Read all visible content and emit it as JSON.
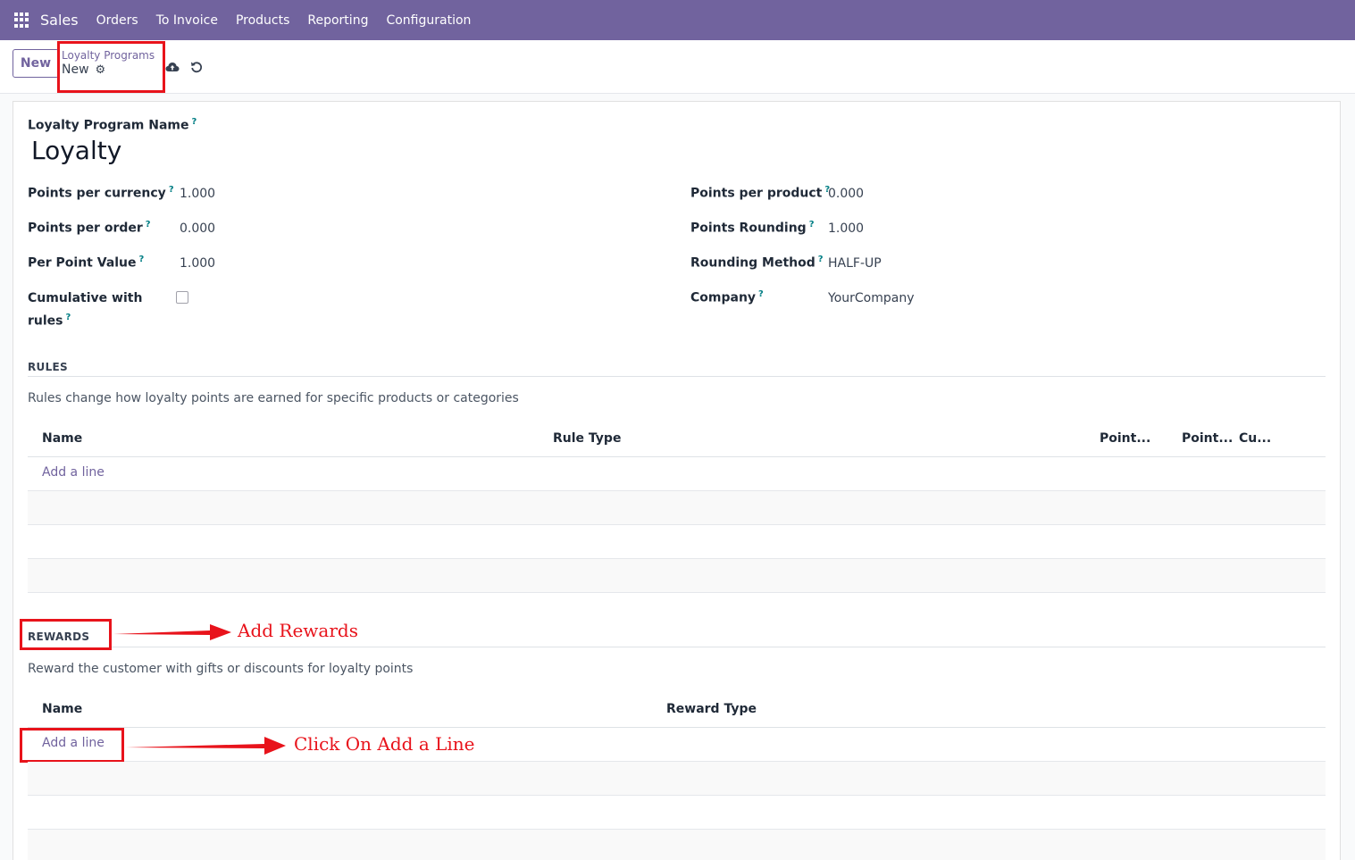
{
  "navbar": {
    "app_name": "Sales",
    "menu": [
      "Orders",
      "To Invoice",
      "Products",
      "Reporting",
      "Configuration"
    ]
  },
  "control": {
    "new_button": "New",
    "breadcrumb_parent": "Loyalty Programs",
    "breadcrumb_current": "New"
  },
  "form": {
    "name_label": "Loyalty Program Name",
    "name_value": "Loyalty",
    "left_fields": [
      {
        "label": "Points per currency",
        "value": "1.000"
      },
      {
        "label": "Points per order",
        "value": "0.000"
      },
      {
        "label": "Per Point Value",
        "value": "1.000"
      }
    ],
    "cumulative_label_1": "Cumulative with",
    "cumulative_label_2": "rules",
    "cumulative_checked": false,
    "right_fields": [
      {
        "label": "Points per product",
        "value": "0.000"
      },
      {
        "label": "Points Rounding",
        "value": "1.000"
      },
      {
        "label": "Rounding Method",
        "value": "HALF-UP"
      },
      {
        "label": "Company",
        "value": "YourCompany"
      }
    ],
    "help_mark": "?"
  },
  "rules": {
    "title": "RULES",
    "help": "Rules change how loyalty points are earned for specific products or categories",
    "columns": [
      "Name",
      "Rule Type",
      "Point...",
      "Point...",
      "Cu..."
    ],
    "add_line": "Add a line"
  },
  "rewards": {
    "title": "REWARDS",
    "help": "Reward the customer with gifts or discounts for loyalty points",
    "columns": [
      "Name",
      "Reward Type"
    ],
    "add_line": "Add a line"
  },
  "annotations": {
    "add_rewards": "Add Rewards",
    "click_add_line": "Click On Add a Line",
    "color": "#e8131b"
  },
  "colors": {
    "brand": "#71639e",
    "help_mark": "#017e84"
  }
}
